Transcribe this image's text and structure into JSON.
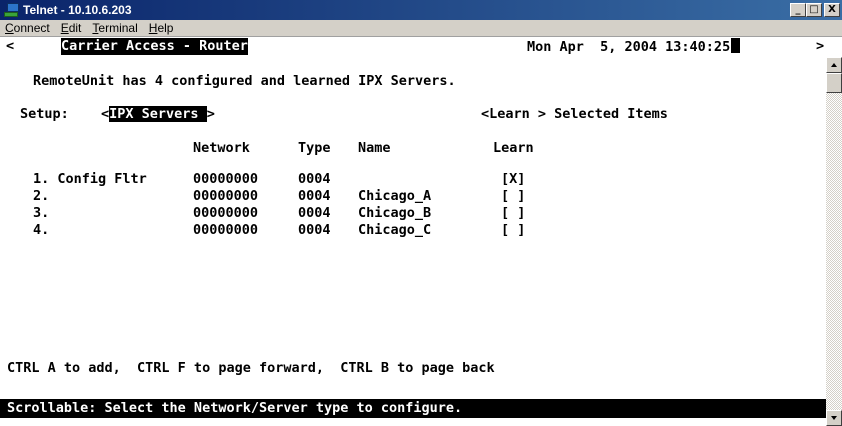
{
  "window": {
    "title": "Telnet - 10.10.6.203",
    "buttons": {
      "minimize": "_",
      "maximize": "□",
      "close": "X"
    }
  },
  "menu": {
    "connect": {
      "u": "C",
      "rest": "onnect"
    },
    "edit": {
      "u": "E",
      "rest": "dit"
    },
    "terminal": {
      "u": "T",
      "rest": "erminal"
    },
    "help": {
      "u": "H",
      "rest": "elp"
    }
  },
  "screen": {
    "nav_left": "<",
    "nav_right": ">",
    "product": "Carrier Access - Router",
    "datetime": "Mon Apr  5, 2004 13:40:25",
    "summary": "RemoteUnit has 4 configured and learned IPX Servers.",
    "setup_label": "Setup:",
    "setup_open": "<",
    "setup_value": "IPX Servers ",
    "setup_close": ">",
    "learn_selected": "<Learn > Selected Items",
    "columns": {
      "network": "Network",
      "type": "Type",
      "name": "Name",
      "learn": "Learn"
    },
    "rows": [
      {
        "index": "1. Config Fltr",
        "network": "00000000",
        "type": "0004",
        "name": "",
        "learn": "[X]"
      },
      {
        "index": "2.",
        "network": "00000000",
        "type": "0004",
        "name": "Chicago_A",
        "learn": "[ ]"
      },
      {
        "index": "3.",
        "network": "00000000",
        "type": "0004",
        "name": "Chicago_B",
        "learn": "[ ]"
      },
      {
        "index": "4.",
        "network": "00000000",
        "type": "0004",
        "name": "Chicago_C",
        "learn": "[ ]"
      }
    ],
    "help_line": "CTRL A to add,  CTRL F to page forward,  CTRL B to page back",
    "status": "Scrollable: Select the Network/Server type to configure."
  }
}
